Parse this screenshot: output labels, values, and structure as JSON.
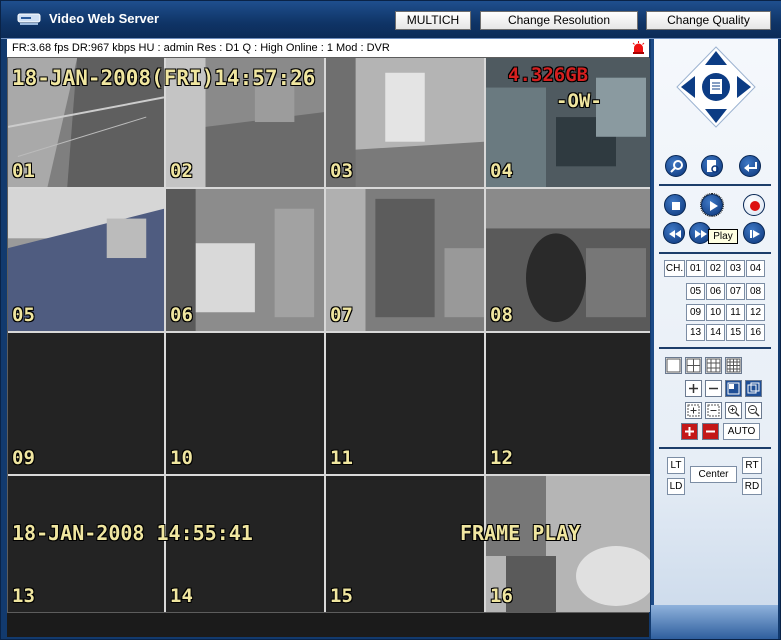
{
  "title": "Video Web Server",
  "buttons": {
    "multich": "MULTICH",
    "change_resolution": "Change Resolution",
    "change_quality": "Change Quality"
  },
  "status": "FR:3.68 fps  DR:967 kbps  HU : admin  Res : D1  Q : High  Online : 1 Mod : DVR",
  "osd": {
    "date_top": "18-JAN-2008(FRI)14:57:26",
    "hdd": "4.326GB",
    "hdd_mode": "-OW-",
    "date_bottom": "18-JAN-2008 14:55:41",
    "frame_play": "FRAME PLAY"
  },
  "channels": [
    "01",
    "02",
    "03",
    "04",
    "05",
    "06",
    "07",
    "08",
    "09",
    "10",
    "11",
    "12",
    "13",
    "14",
    "15",
    "16"
  ],
  "channel_buttons": {
    "ch": "CH.",
    "numbers": [
      "01",
      "02",
      "03",
      "04",
      "05",
      "06",
      "07",
      "08",
      "09",
      "10",
      "11",
      "12",
      "13",
      "14",
      "15",
      "16"
    ]
  },
  "ptz": {
    "auto": "AUTO",
    "lt": "LT",
    "ld": "LD",
    "center": "Center",
    "rt": "RT",
    "rd": "RD"
  },
  "tooltip": "Play",
  "colors": {
    "title_bg": "#0f3466",
    "osd_text": "#f0e6a0",
    "hdd_text": "#d42020",
    "button_blue": "#0b3478"
  }
}
